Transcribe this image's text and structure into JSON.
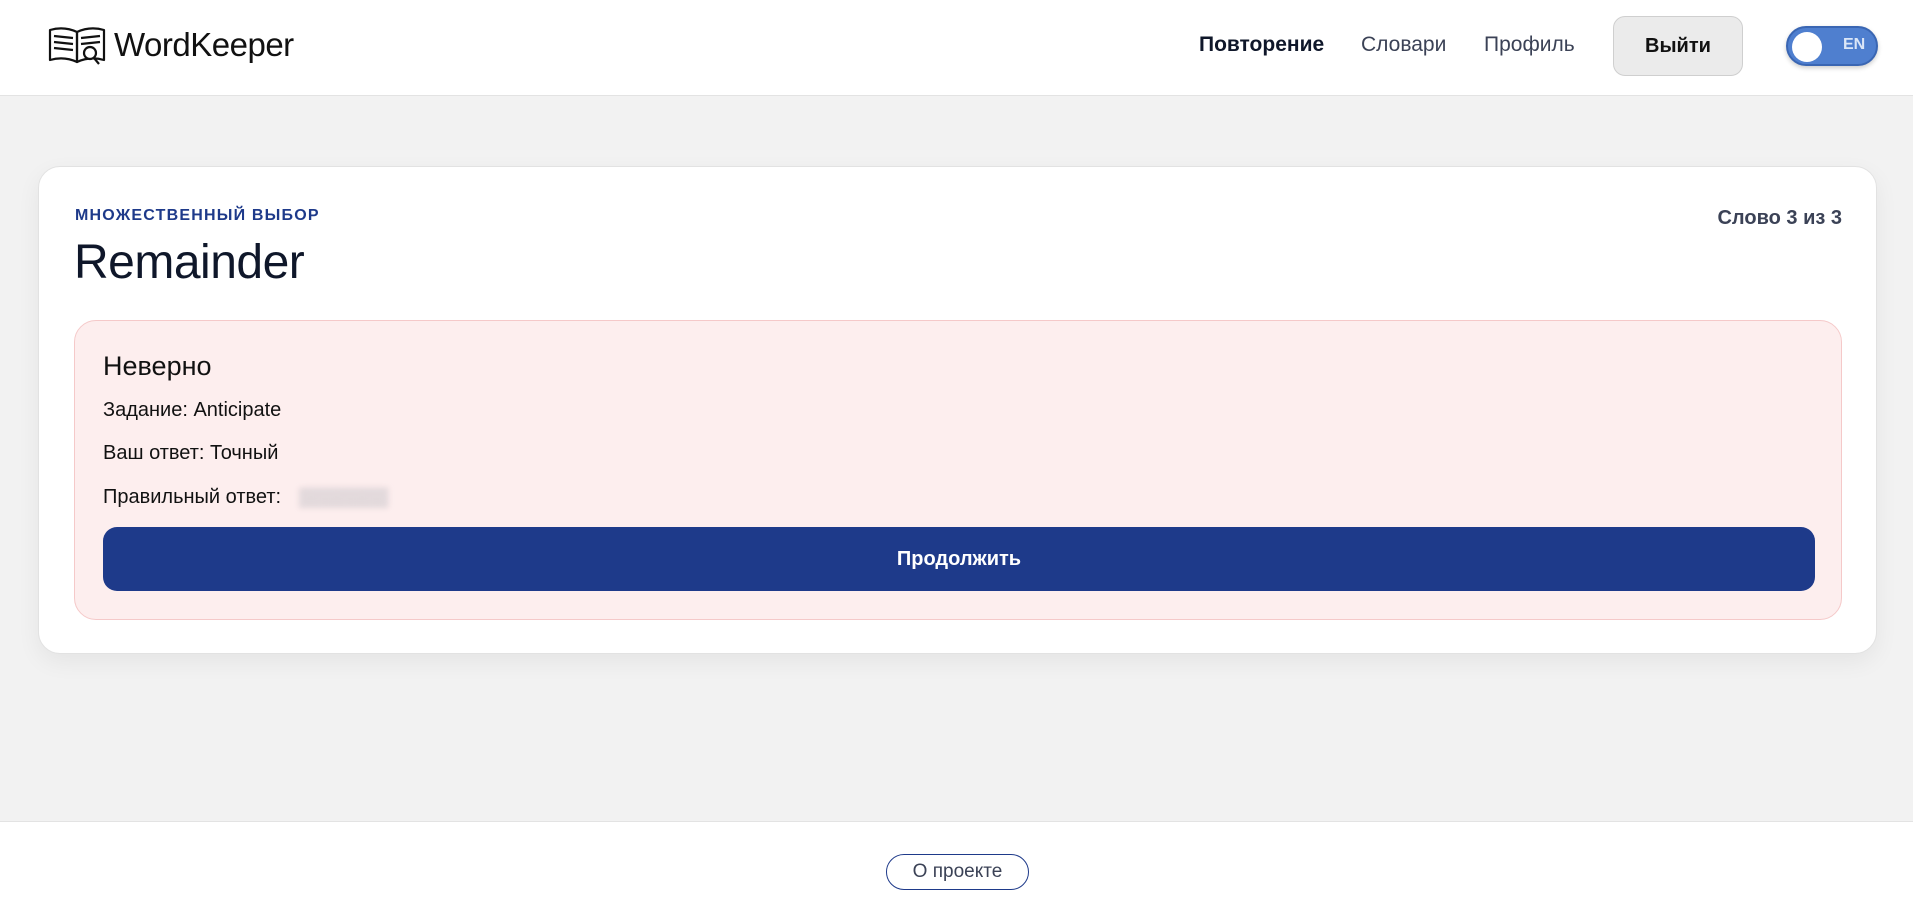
{
  "header": {
    "logo_text": "WordKeeper",
    "logo_icon": "open-book-magnifier-icon",
    "nav": {
      "review": "Повторение",
      "dictionaries": "Словари",
      "profile": "Профиль"
    },
    "logout_label": "Выйти",
    "language_toggle": {
      "label": "EN",
      "enabled": true
    }
  },
  "exercise": {
    "type_label": "МНОЖЕСТВЕННЫЙ ВЫБОР",
    "counter": "Слово 3 из 3",
    "word": "Remainder"
  },
  "result": {
    "heading": "Неверно",
    "task_line": "Задание: Anticipate",
    "your_answer_line": "Ваш ответ: Точный",
    "correct_answer_label": "Правильный ответ:",
    "continue_label": "Продолжить"
  },
  "footer": {
    "about_label": "О проекте"
  },
  "colors": {
    "accent": "#1e3a8a",
    "error_bg": "#fdeeee",
    "error_border": "#f5c9c9",
    "toggle_bg": "#4f7fcf"
  }
}
